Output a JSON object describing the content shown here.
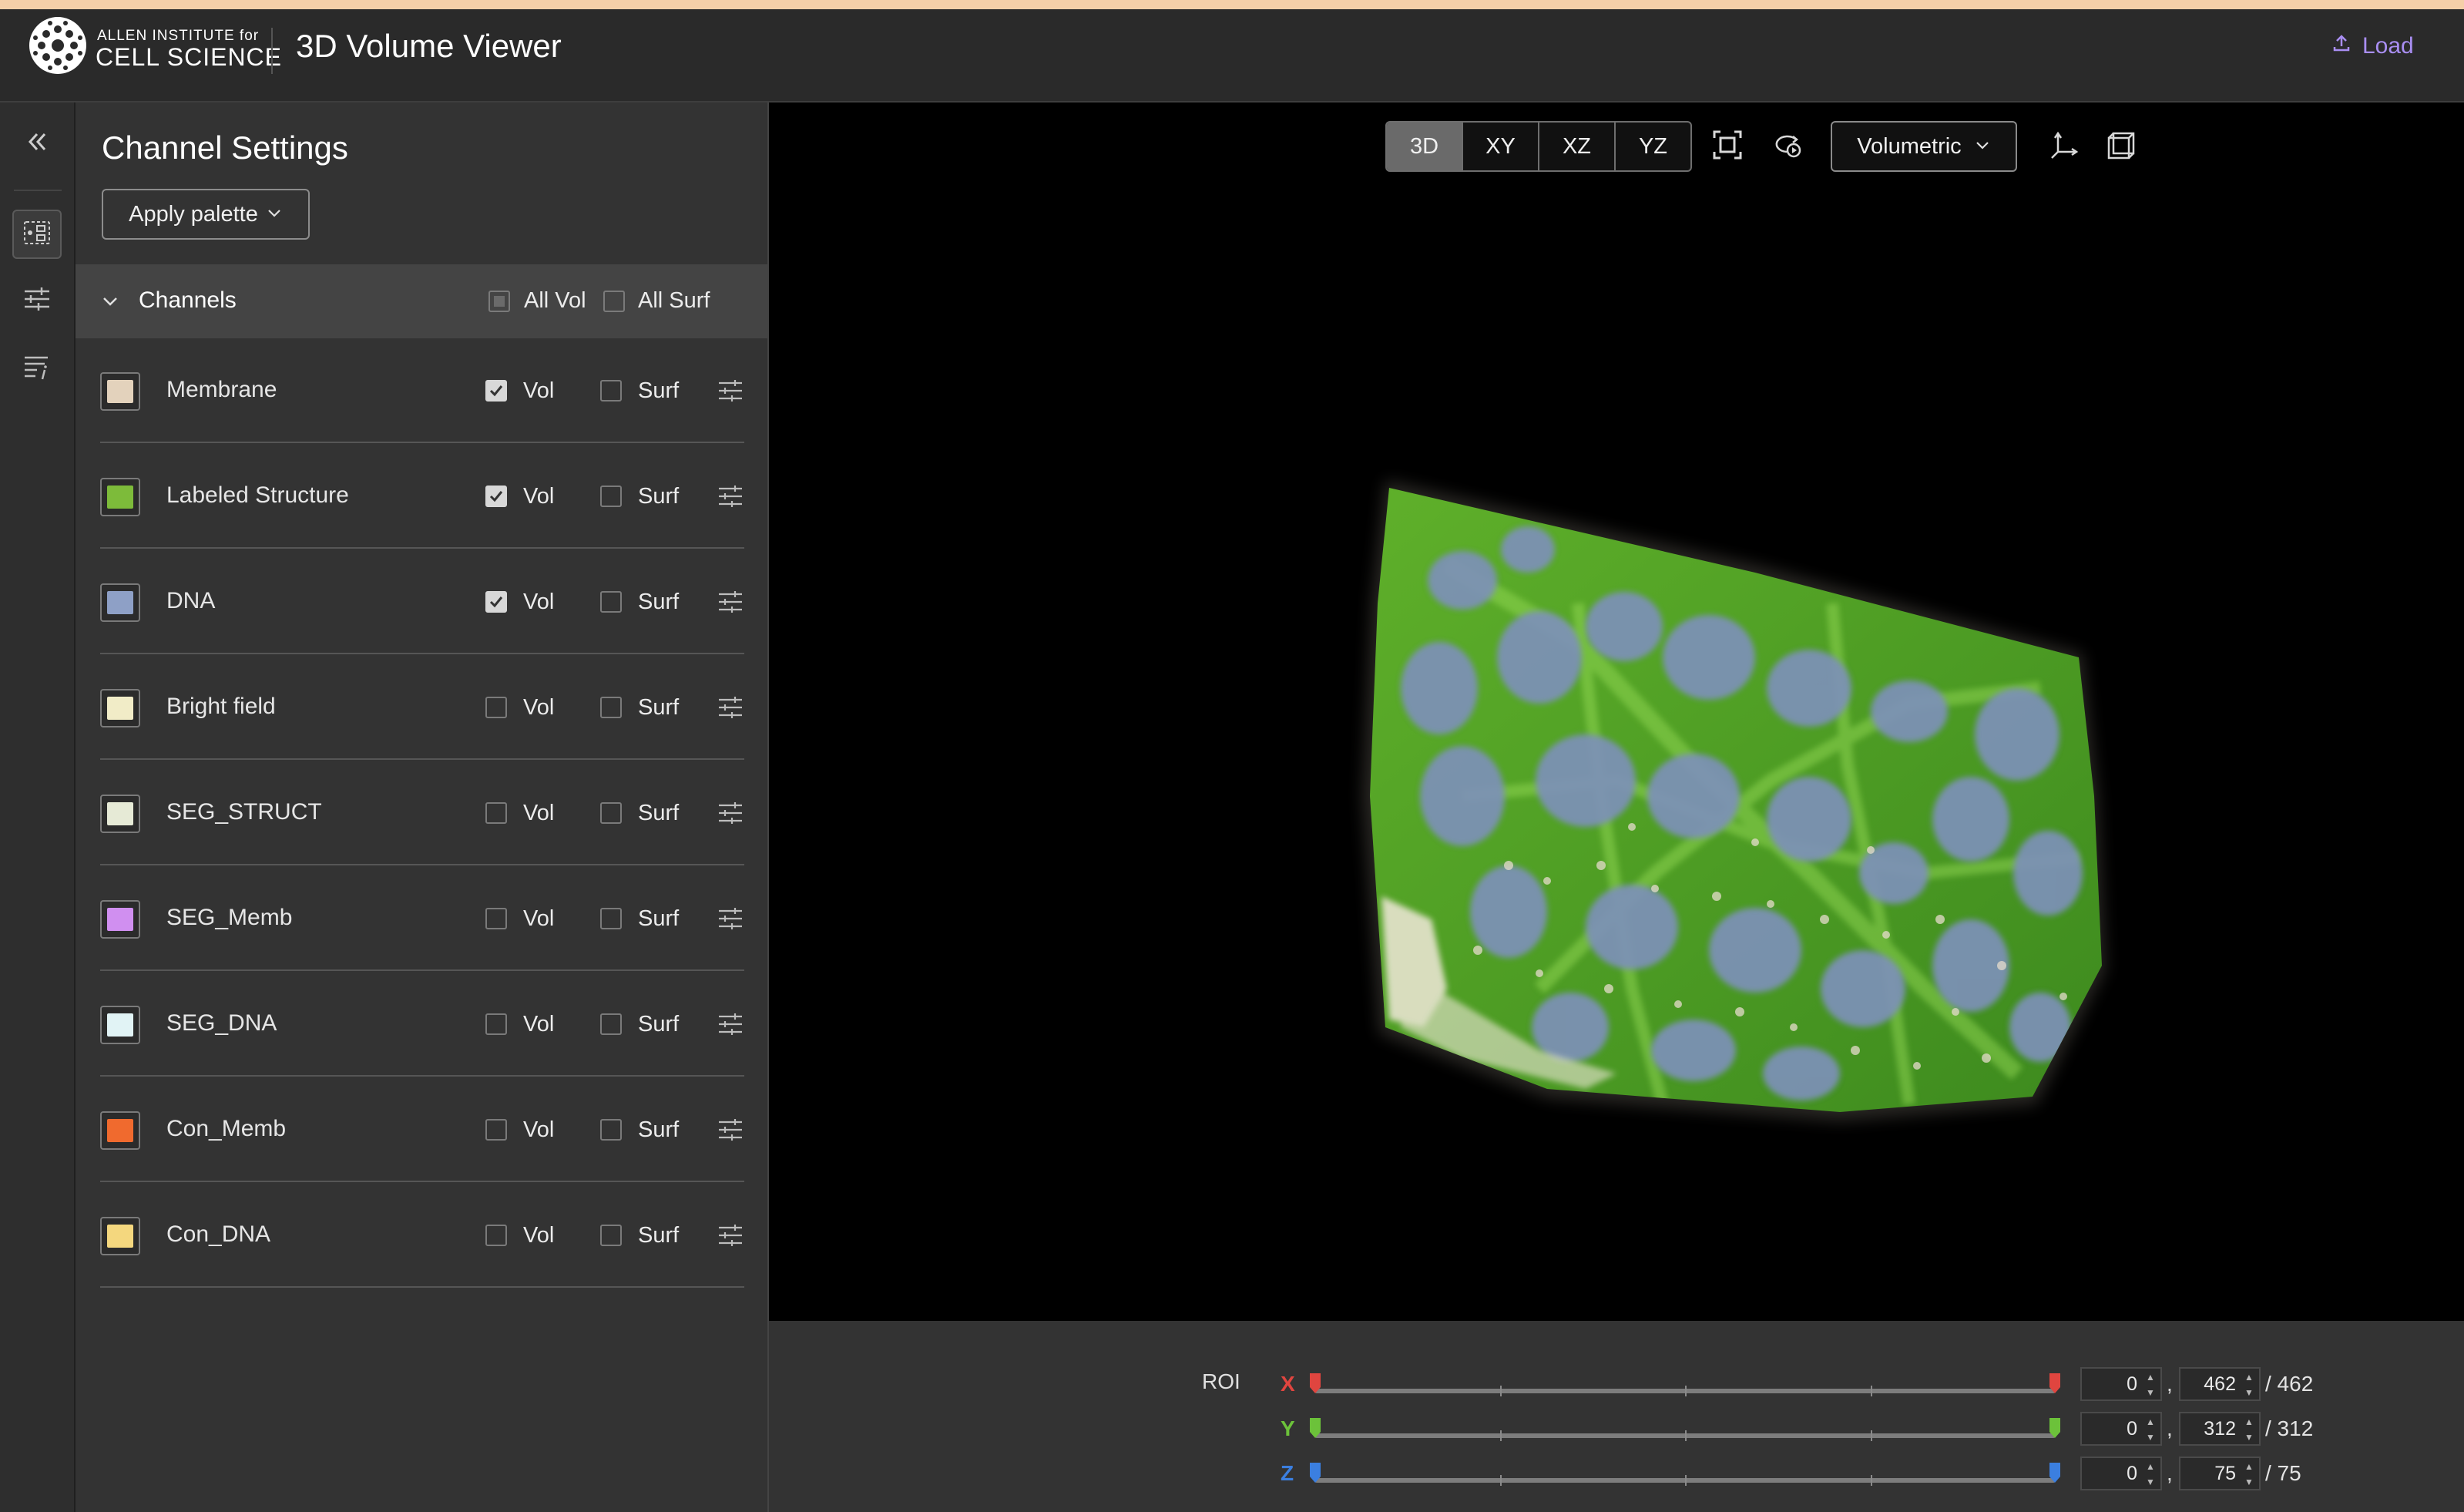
{
  "header": {
    "logo_line1": "ALLEN INSTITUTE for",
    "logo_line2": "CELL SCIENCE",
    "title": "3D Volume Viewer",
    "load_label": "Load"
  },
  "panel": {
    "title": "Channel Settings",
    "apply_palette_label": "Apply palette",
    "channels_header": "Channels",
    "all_vol_label": "All Vol",
    "all_surf_label": "All Surf",
    "vol_label": "Vol",
    "surf_label": "Surf"
  },
  "channels": [
    {
      "name": "Membrane",
      "color": "#e3d2bc",
      "vol": true,
      "surf": false
    },
    {
      "name": "Labeled Structure",
      "color": "#7dbb3a",
      "vol": true,
      "surf": false
    },
    {
      "name": "DNA",
      "color": "#8ea0c6",
      "vol": true,
      "surf": false
    },
    {
      "name": "Bright field",
      "color": "#f1ecc7",
      "vol": false,
      "surf": false
    },
    {
      "name": "SEG_STRUCT",
      "color": "#e6ead6",
      "vol": false,
      "surf": false
    },
    {
      "name": "SEG_Memb",
      "color": "#d08ff0",
      "vol": false,
      "surf": false
    },
    {
      "name": "SEG_DNA",
      "color": "#e1f3f5",
      "vol": false,
      "surf": false
    },
    {
      "name": "Con_Memb",
      "color": "#f06a2e",
      "vol": false,
      "surf": false
    },
    {
      "name": "Con_DNA",
      "color": "#f4d77e",
      "vol": false,
      "surf": false
    }
  ],
  "viewer": {
    "view_modes": [
      "3D",
      "XY",
      "XZ",
      "YZ"
    ],
    "active_view": "3D",
    "render_mode": "Volumetric"
  },
  "roi": {
    "label": "ROI",
    "axes": [
      {
        "axis": "X",
        "color": "#e0453f",
        "min": "0",
        "max": "462",
        "total": "/ 462"
      },
      {
        "axis": "Y",
        "color": "#6cc23a",
        "min": "0",
        "max": "312",
        "total": "/ 312"
      },
      {
        "axis": "Z",
        "color": "#3b7fe0",
        "min": "0",
        "max": "75",
        "total": "/ 75"
      }
    ]
  }
}
